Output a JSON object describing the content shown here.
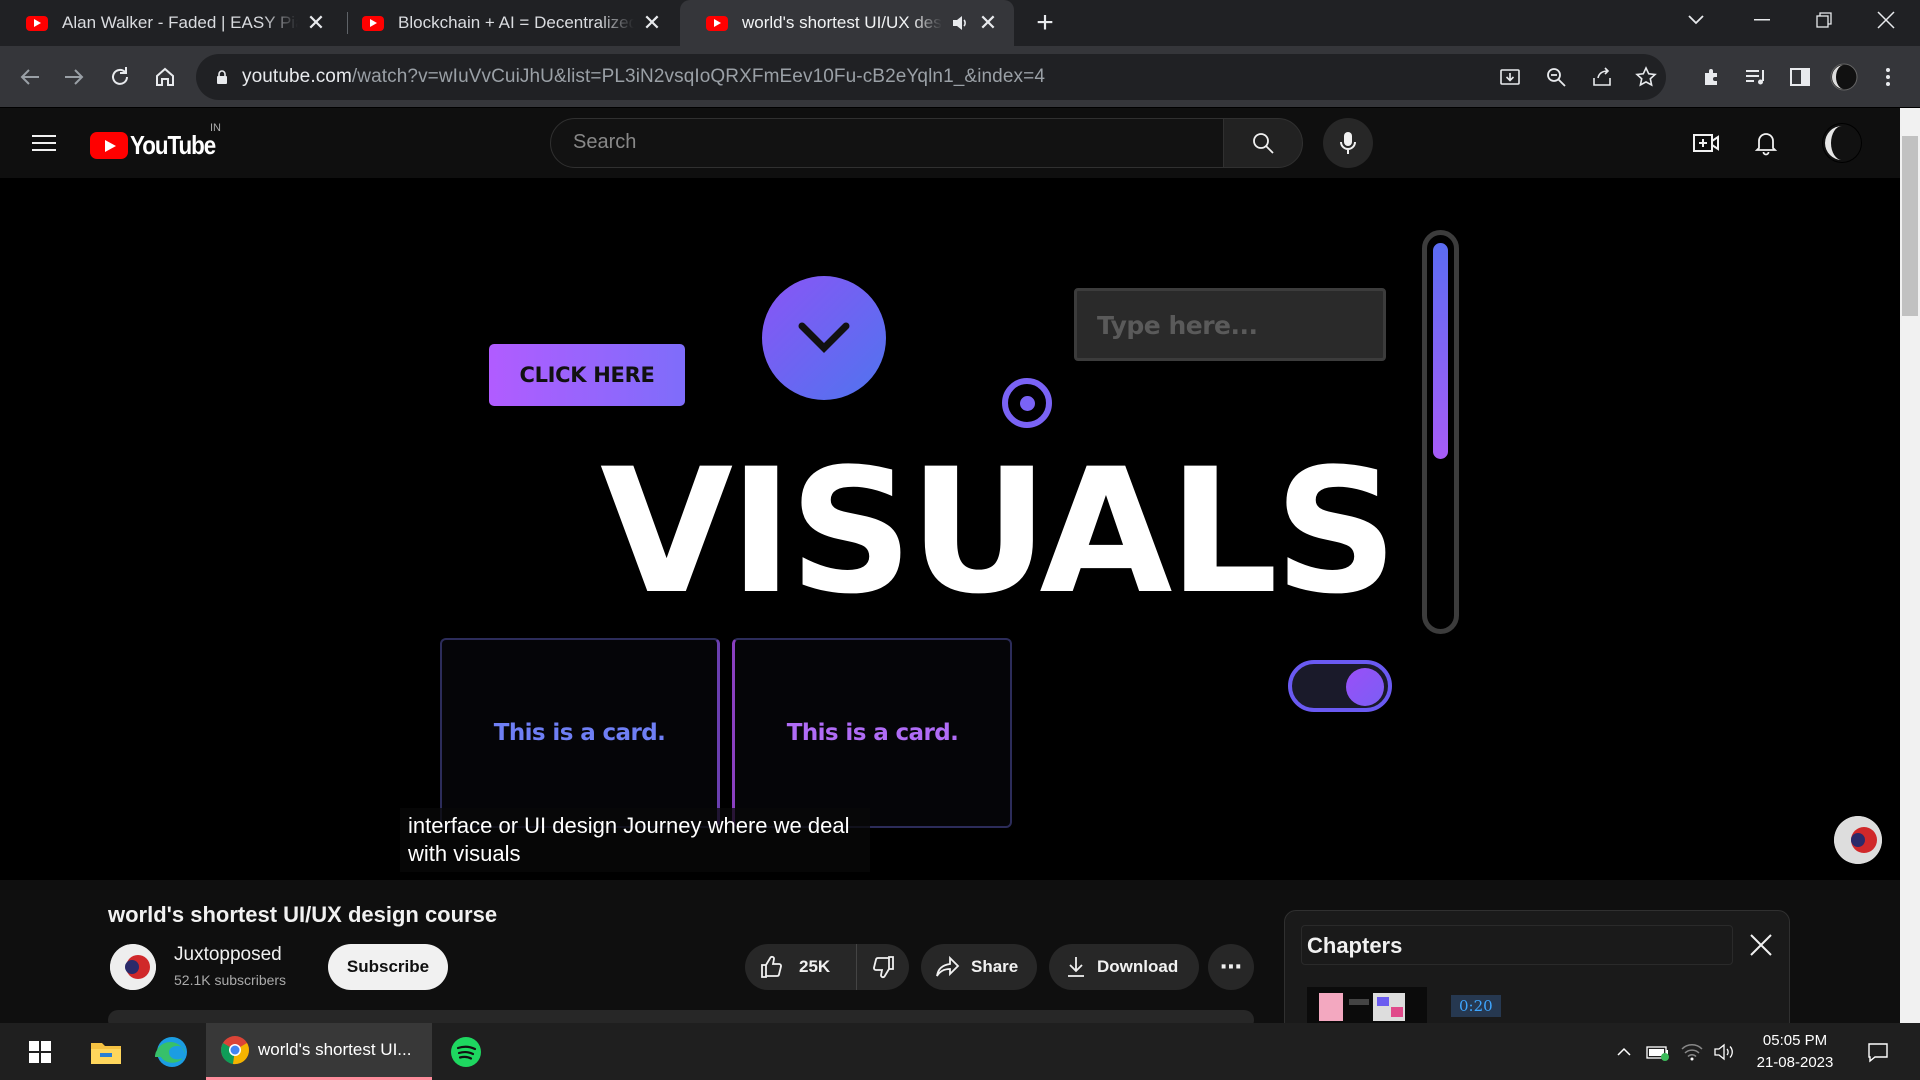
{
  "browser": {
    "tabs": [
      {
        "title": "Alan Walker - Faded | EASY Piano Tutorial",
        "active": false
      },
      {
        "title": "Blockchain + AI = Decentralized AI",
        "active": false
      },
      {
        "title": "world's shortest UI/UX design course",
        "active": true
      }
    ],
    "address": {
      "host": "youtube.com",
      "path": "/watch?v=wIuVvCuiJhU&list=PL3iN2vsqIoQRXFmEev10Fu-cB2eYqln1_&index=4"
    }
  },
  "youtube": {
    "logo_text": "YouTube",
    "country_code": "IN",
    "search_placeholder": "Search"
  },
  "video": {
    "demo_button": "CLICK HERE",
    "demo_input_placeholder": "Type here...",
    "headline": "VISUALS",
    "demo_card_1": "This is a card.",
    "demo_card_2": "This is a card.",
    "captions": "interface or UI design Journey where we deal with visuals"
  },
  "meta": {
    "title": "world's shortest UI/UX design course",
    "channel_name": "Juxtopposed",
    "subscribers": "52.1K subscribers",
    "subscribe_label": "Subscribe",
    "like_count": "25K",
    "share_label": "Share",
    "download_label": "Download",
    "more_label": "⋯"
  },
  "chapters": {
    "title": "Chapters",
    "first_time": "0:20"
  },
  "taskbar": {
    "chrome_label": "world's shortest UI...",
    "time": "05:05 PM",
    "date": "21-08-2023"
  },
  "colors": {
    "yt_red": "#ff0000",
    "accent_purple": "#8a55f5",
    "accent_blue": "#4f74ef"
  }
}
